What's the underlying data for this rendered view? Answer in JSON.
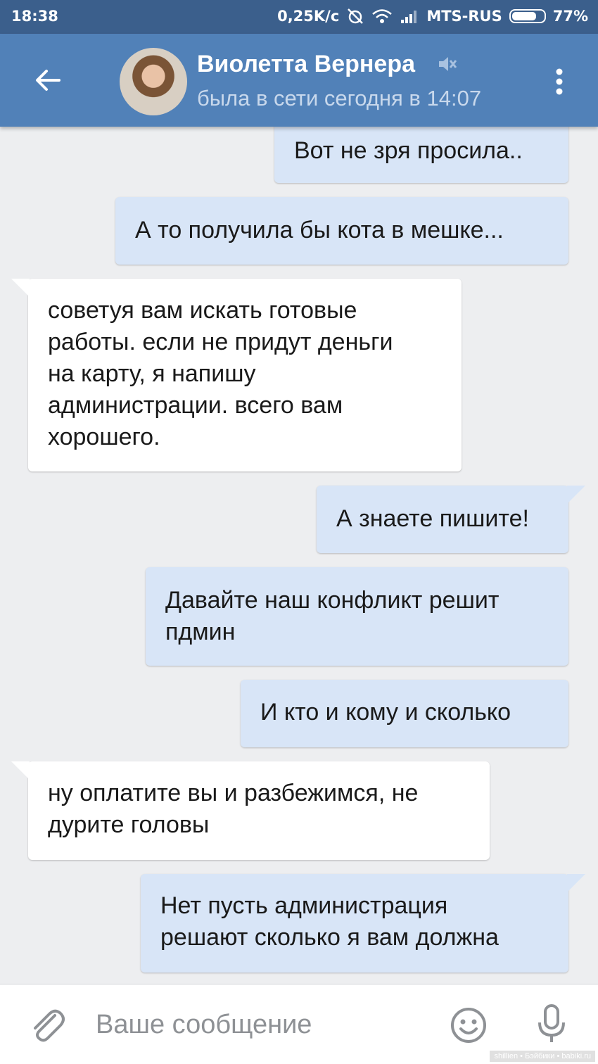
{
  "status_bar": {
    "time": "18:38",
    "speed": "0,25K/c",
    "carrier": "MTS-RUS",
    "battery": "77%",
    "battery_level": 0.77
  },
  "header": {
    "contact_name": "Виолетта Вернера",
    "last_seen": "была в сети сегодня в 14:07",
    "icons": [
      "back-arrow-icon",
      "mute-icon",
      "more-vertical-icon"
    ]
  },
  "messages": [
    {
      "direction": "outgoing",
      "text": "Вот не зря просила.."
    },
    {
      "direction": "outgoing",
      "text": "А то получила бы кота в мешке..."
    },
    {
      "direction": "incoming",
      "lines": [
        "советуя вам искать готовые",
        "работы. если не придут деньги",
        "на карту, я напишу",
        "администрации. всего вам",
        "хорошего."
      ]
    },
    {
      "direction": "outgoing",
      "text": "А знаете пишите!"
    },
    {
      "direction": "outgoing",
      "lines": [
        "Давайте наш конфликт решит",
        "пдмин"
      ]
    },
    {
      "direction": "outgoing",
      "text": "И кто и кому и сколько"
    },
    {
      "direction": "incoming",
      "lines": [
        "ну оплатите вы и разбежимся, не",
        "дурите головы"
      ]
    },
    {
      "direction": "outgoing",
      "lines": [
        "Нет пусть администрация",
        "решают сколько я вам должна"
      ]
    }
  ],
  "composer": {
    "placeholder": "Ваше сообщение",
    "icons": [
      "paperclip-icon",
      "smile-icon",
      "microphone-icon"
    ]
  },
  "watermark": "shillien • Бэйбики • babiki.ru",
  "colors": {
    "status_bar": "#3b5f8c",
    "header": "#5181b8",
    "background": "#edeef0",
    "outgoing_bubble": "#d8e5f7",
    "incoming_bubble": "#ffffff"
  }
}
